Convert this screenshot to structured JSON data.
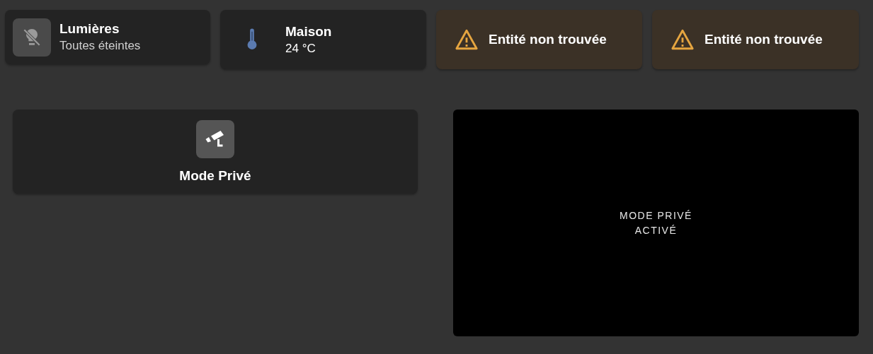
{
  "top_cards": [
    {
      "kind": "tile",
      "name": "Lumières",
      "state": "Toutes éteintes"
    },
    {
      "kind": "sensor",
      "name": "Maison",
      "state": "24 °C"
    },
    {
      "kind": "warning",
      "name": "Entité non trouvée"
    },
    {
      "kind": "warning",
      "name": "Entité non trouvée"
    }
  ],
  "privacy_tile": {
    "name": "Mode Privé"
  },
  "camera_view": {
    "lines": [
      "MODE PRIVÉ",
      "ACTIVÉ"
    ]
  }
}
